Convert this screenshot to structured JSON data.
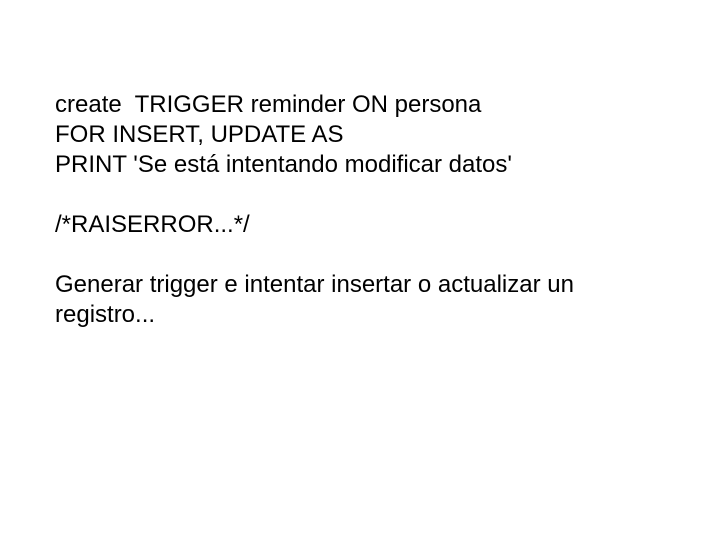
{
  "code": {
    "line1": "create  TRIGGER reminder ON persona",
    "line2": "FOR INSERT, UPDATE AS",
    "line3": "PRINT 'Se está intentando modificar datos'"
  },
  "comment": "/*RAISERROR...*/",
  "instruction": "Generar trigger e intentar insertar o actualizar un registro..."
}
